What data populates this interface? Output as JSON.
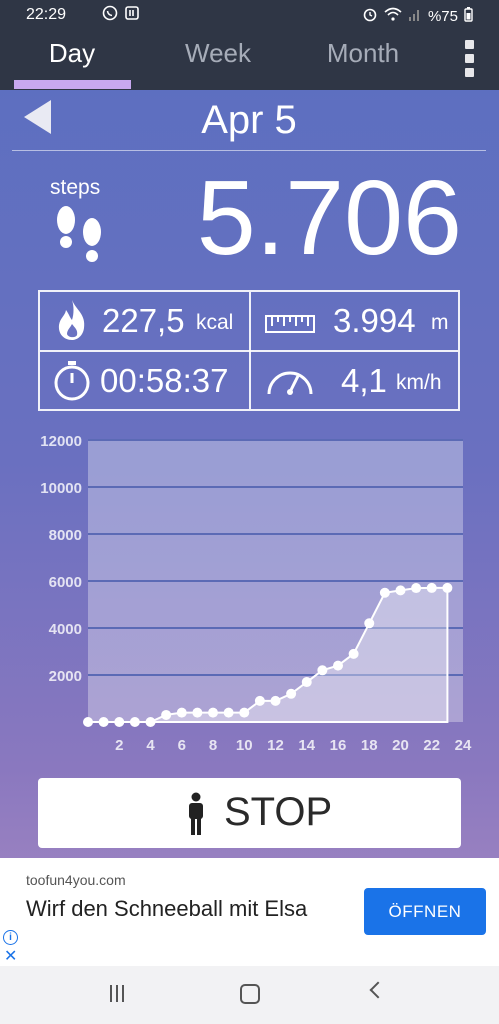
{
  "status": {
    "time": "22:29",
    "battery": "%75",
    "icons_left": [
      "whatsapp-icon",
      "notification-icon"
    ],
    "icons_right": [
      "alarm-icon",
      "wifi-icon",
      "signal-icon",
      "battery-icon"
    ]
  },
  "tabs": [
    {
      "label": "Day",
      "active": true
    },
    {
      "label": "Week",
      "active": false
    },
    {
      "label": "Month",
      "active": false
    }
  ],
  "date": "Apr 5",
  "steps": {
    "label": "steps",
    "value": "5.706"
  },
  "stats": {
    "calories": {
      "value": "227,5",
      "unit": "kcal"
    },
    "distance": {
      "value": "3.994",
      "unit": "m"
    },
    "duration": {
      "value": "00:58:37"
    },
    "speed": {
      "value": "4,1",
      "unit": "km/h"
    }
  },
  "chart_data": {
    "type": "area",
    "title": "",
    "xlabel": "",
    "ylabel": "",
    "xlim": [
      0,
      24
    ],
    "ylim": [
      0,
      12000
    ],
    "x_ticks": [
      2,
      4,
      6,
      8,
      10,
      12,
      14,
      16,
      18,
      20,
      22,
      24
    ],
    "y_ticks": [
      2000,
      4000,
      6000,
      8000,
      10000,
      12000
    ],
    "grid": true,
    "x": [
      0,
      1,
      2,
      3,
      4,
      5,
      6,
      7,
      8,
      9,
      10,
      11,
      12,
      13,
      14,
      15,
      16,
      17,
      18,
      19,
      20,
      21,
      22,
      23
    ],
    "values": [
      0,
      0,
      0,
      0,
      0,
      300,
      400,
      400,
      400,
      400,
      400,
      900,
      900,
      1200,
      1700,
      2200,
      2400,
      2900,
      4200,
      5500,
      5600,
      5700,
      5706,
      5706
    ]
  },
  "stop_button": {
    "label": "STOP"
  },
  "ad": {
    "domain": "toofun4you.com",
    "headline": "Wirf den Schneeball mit Elsa",
    "cta": "ÖFFNEN"
  },
  "navbar": {
    "items": [
      "recents-icon",
      "home-icon",
      "back-icon"
    ]
  }
}
